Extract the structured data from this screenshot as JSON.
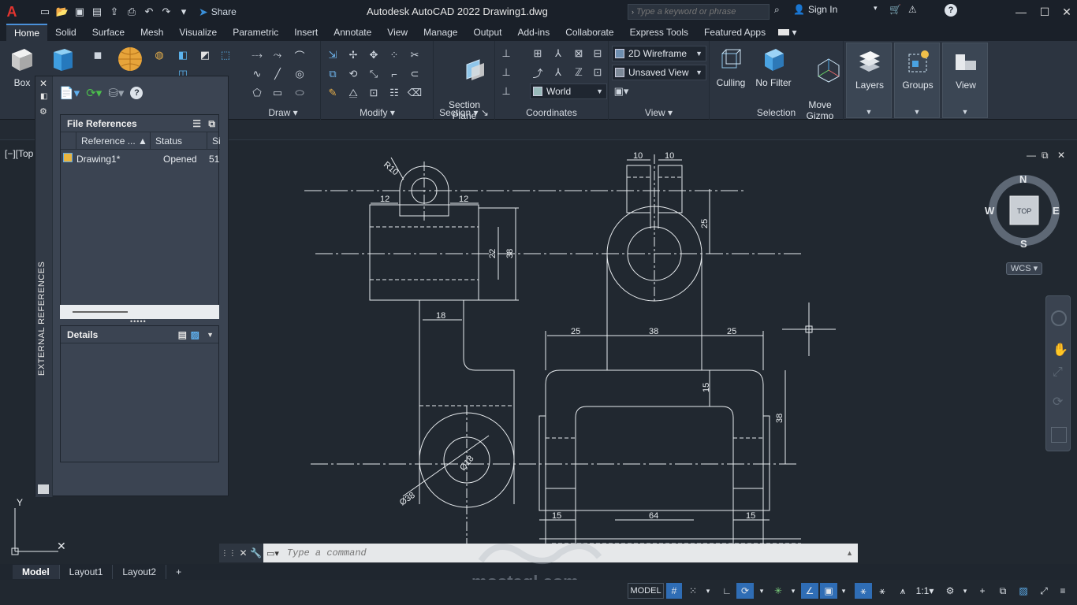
{
  "titlebar": {
    "app_icon": "A",
    "share_label": "Share",
    "title": "Autodesk AutoCAD 2022   Drawing1.dwg",
    "search_placeholder": "Type a keyword or phrase",
    "signin_label": "Sign In",
    "help_label": "?"
  },
  "tabs": [
    "Home",
    "Solid",
    "Surface",
    "Mesh",
    "Visualize",
    "Parametric",
    "Insert",
    "Annotate",
    "View",
    "Manage",
    "Output",
    "Add-ins",
    "Collaborate",
    "Express Tools",
    "Featured Apps"
  ],
  "ribbon": {
    "box_label": "Box",
    "draw_label": "Draw",
    "modify_label": "Modify",
    "section_plane_label": "Section\nPlane",
    "section_label": "Section",
    "coordinates_label": "Coordinates",
    "world_value": "World",
    "visual_style_value": "2D Wireframe",
    "view_value": "Unsaved View",
    "view_label": "View",
    "culling_label": "Culling",
    "no_filter_label": "No Filter",
    "move_gizmo_label": "Move\nGizmo",
    "selection_label": "Selection",
    "layers_label": "Layers",
    "groups_label": "Groups",
    "view_btn_label": "View"
  },
  "viewport_label": "[−][Top",
  "palette": {
    "title": "EXTERNAL REFERENCES",
    "file_references_label": "File References",
    "columns": [
      "Reference ...",
      "Status",
      "Si"
    ],
    "rows": [
      {
        "name": "Drawing1*",
        "status": "Opened",
        "size": "51."
      }
    ],
    "details_label": "Details"
  },
  "viewcube": {
    "n": "N",
    "s": "S",
    "e": "E",
    "w": "W",
    "face": "TOP",
    "wcs": "WCS"
  },
  "drawing": {
    "dims": [
      "10",
      "10",
      "R10",
      "12",
      "12",
      "25",
      "22",
      "38",
      "18",
      "25",
      "38",
      "25",
      "15",
      "38",
      "Ø38",
      "Ø18",
      "15",
      "64",
      "15"
    ]
  },
  "command": {
    "placeholder": "Type a command"
  },
  "layout_tabs": [
    "Model",
    "Layout1",
    "Layout2",
    "+"
  ],
  "status": {
    "model_label": "MODEL",
    "scale_label": "1:1"
  },
  "watermark": "mostaql.com"
}
